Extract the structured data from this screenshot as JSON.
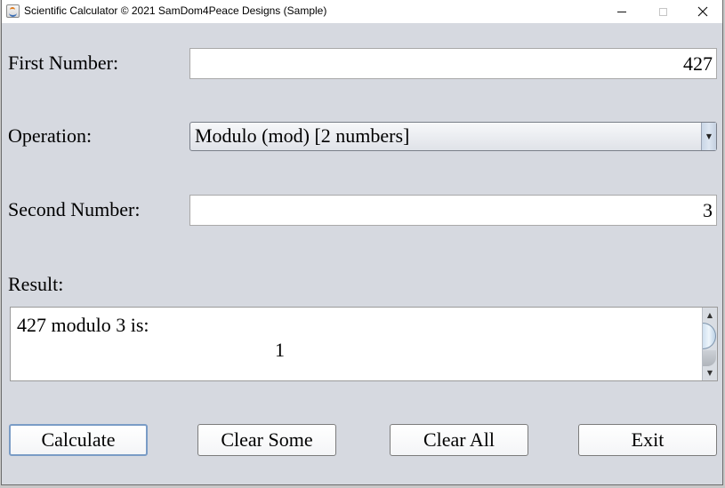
{
  "window": {
    "title": "Scientific Calculator © 2021 SamDom4Peace Designs (Sample)",
    "icon": "java-cup-icon",
    "controls": [
      "minimize",
      "maximize",
      "close"
    ]
  },
  "form": {
    "first_number_label": "First Number:",
    "first_number_value": "427",
    "operation_label": "Operation:",
    "operation_selected": "Modulo (mod) [2 numbers]",
    "second_number_label": "Second Number:",
    "second_number_value": "3",
    "result_label": "Result:",
    "result_line1": "427 modulo 3 is:",
    "result_line2": "1"
  },
  "buttons": {
    "calculate": "Calculate",
    "clear_some": "Clear Some",
    "clear_all": "Clear All",
    "exit": "Exit"
  },
  "icons": {
    "combo_arrow": "▼",
    "scroll_up": "▲",
    "scroll_down": "▼"
  }
}
